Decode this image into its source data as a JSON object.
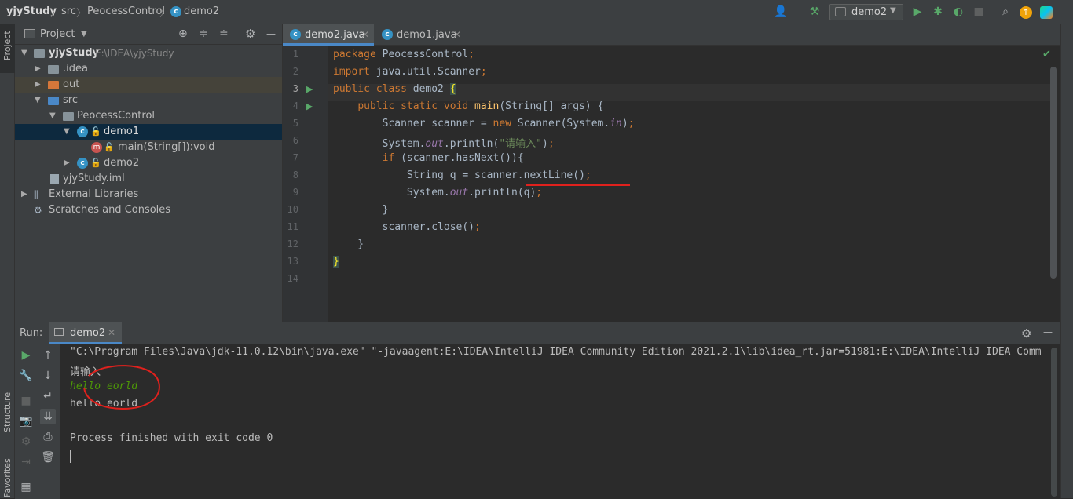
{
  "breadcrumb": [
    "yjyStudy",
    "src",
    "PeocessControl",
    "demo2"
  ],
  "toolbar": {
    "run_config": "demo2"
  },
  "project_panel": {
    "title": "Project",
    "tree": [
      {
        "label": "yjyStudy",
        "path": "E:\\IDEA\\yjyStudy",
        "type": "module"
      },
      {
        "label": ".idea",
        "type": "folder"
      },
      {
        "label": "out",
        "type": "folder-orange"
      },
      {
        "label": "src",
        "type": "folder-blue"
      },
      {
        "label": "PeocessControl",
        "type": "package"
      },
      {
        "label": "demo1",
        "type": "class"
      },
      {
        "label": "main(String[]):void",
        "type": "method"
      },
      {
        "label": "demo2",
        "type": "class"
      },
      {
        "label": "yjyStudy.iml",
        "type": "file"
      },
      {
        "label": "External Libraries",
        "type": "lib"
      },
      {
        "label": "Scratches and Consoles",
        "type": "scratch"
      }
    ]
  },
  "left_strip": {
    "project": "Project",
    "structure": "Structure",
    "favorites": "Favorites"
  },
  "tabs": [
    {
      "label": "demo2.java",
      "active": true
    },
    {
      "label": "demo1.java",
      "active": false
    }
  ],
  "code_lines": [
    "1",
    "2",
    "3",
    "4",
    "5",
    "6",
    "7",
    "8",
    "9",
    "10",
    "11",
    "12",
    "13",
    "14"
  ],
  "run": {
    "label": "Run:",
    "tab": "demo2",
    "output": [
      "\"C:\\Program Files\\Java\\jdk-11.0.12\\bin\\java.exe\" \"-javaagent:E:\\IDEA\\IntelliJ IDEA Community Edition 2021.2.1\\lib\\idea_rt.jar=51981:E:\\IDEA\\IntelliJ IDEA Comm",
      "请输入",
      "hello eorld",
      "hello eorld",
      "",
      "Process finished with exit code 0"
    ]
  },
  "colors": {
    "accent": "#4a88c7",
    "keyword": "#cc7832",
    "string": "#6a8759",
    "annotation_red": "#e0211d"
  }
}
